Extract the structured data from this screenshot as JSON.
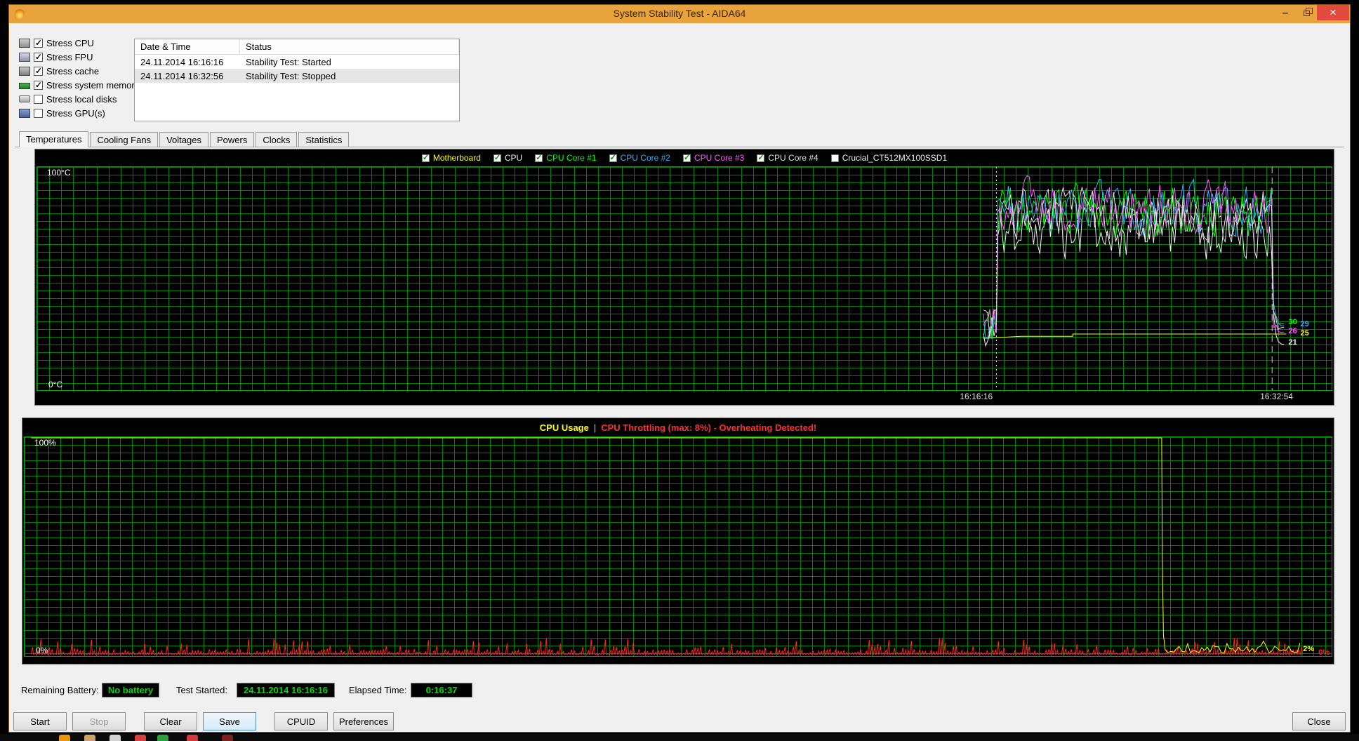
{
  "window": {
    "title": "System Stability Test - AIDA64"
  },
  "stress_options": {
    "items": [
      {
        "label": "Stress CPU",
        "checked": true,
        "icon": "cpu-icon"
      },
      {
        "label": "Stress FPU",
        "checked": true,
        "icon": "fpu-icon"
      },
      {
        "label": "Stress cache",
        "checked": true,
        "icon": "cache-icon"
      },
      {
        "label": "Stress system memory",
        "checked": true,
        "icon": "memory-icon"
      },
      {
        "label": "Stress local disks",
        "checked": false,
        "icon": "disk-icon"
      },
      {
        "label": "Stress GPU(s)",
        "checked": false,
        "icon": "gpu-icon"
      }
    ]
  },
  "log_table": {
    "columns": [
      "Date & Time",
      "Status"
    ],
    "rows": [
      {
        "datetime": "24.11.2014 16:16:16",
        "status": "Stability Test: Started",
        "selected": false
      },
      {
        "datetime": "24.11.2014 16:32:56",
        "status": "Stability Test: Stopped",
        "selected": true
      }
    ]
  },
  "tabs": {
    "items": [
      {
        "label": "Temperatures",
        "active": true
      },
      {
        "label": "Cooling Fans",
        "active": false
      },
      {
        "label": "Voltages",
        "active": false
      },
      {
        "label": "Powers",
        "active": false
      },
      {
        "label": "Clocks",
        "active": false
      },
      {
        "label": "Statistics",
        "active": false
      }
    ]
  },
  "status_bar": {
    "battery_label": "Remaining Battery:",
    "battery_value": "No battery",
    "started_label": "Test Started:",
    "started_value": "24.11.2014 16:16:16",
    "elapsed_label": "Elapsed Time:",
    "elapsed_value": "0:16:37"
  },
  "buttons": {
    "start": "Start",
    "stop": "Stop",
    "clear": "Clear",
    "save": "Save",
    "cpuid": "CPUID",
    "preferences": "Preferences",
    "close": "Close"
  },
  "taskbar": {
    "icons": [
      {
        "name": "taskbar-app-icon-1",
        "color": "#e8960f",
        "x": 84
      },
      {
        "name": "taskbar-app-icon-2",
        "color": "#c9a36a",
        "x": 120
      },
      {
        "name": "taskbar-app-icon-3",
        "color": "#d2d2d2",
        "x": 156
      },
      {
        "name": "taskbar-app-icon-4",
        "color": "#d64040",
        "x": 192
      },
      {
        "name": "taskbar-app-icon-5",
        "color": "#2f9e3f",
        "x": 224
      },
      {
        "name": "taskbar-app-icon-6",
        "color": "#cf3a3a",
        "x": 266
      },
      {
        "name": "taskbar-app-icon-7",
        "color": "#7e1f1f",
        "x": 316
      }
    ]
  },
  "chart_data": [
    {
      "type": "line",
      "title": "Temperatures",
      "grid": true,
      "bg_color": "#000000",
      "grid_color": "#009600",
      "y_axis": {
        "min": 0,
        "max": 100,
        "top_label": "100°C",
        "bottom_label": "0°C"
      },
      "x_ticks": [
        {
          "label": "16:16:16",
          "frac": 0.728
        },
        {
          "label": "16:32:54",
          "frac": 0.96
        }
      ],
      "events": {
        "data_start_frac": 0.731,
        "start_line_frac": 0.741,
        "stop_line_frac": 0.954,
        "data_end_frac": 0.965
      },
      "legend": [
        {
          "name": "Motherboard",
          "color": "#ffff00",
          "checked": true
        },
        {
          "name": "CPU",
          "color": "#f0f0f0",
          "checked": true
        },
        {
          "name": "CPU Core #1",
          "color": "#00ff00",
          "checked": true
        },
        {
          "name": "CPU Core #2",
          "color": "#35b1ff",
          "checked": true
        },
        {
          "name": "CPU Core #3",
          "color": "#ff5cff",
          "checked": true
        },
        {
          "name": "CPU Core #4",
          "color": "#e0e0e0",
          "checked": true
        },
        {
          "name": "Crucial_CT512MX100SSD1",
          "color": "#f0f0f0",
          "checked": false
        }
      ],
      "series": [
        {
          "name": "Motherboard",
          "color": "#ffff00",
          "render": "steps",
          "points": [
            [
              0.731,
              23
            ],
            [
              0.76,
              24
            ],
            [
              0.8,
              24
            ],
            [
              0.8,
              25
            ],
            [
              0.9,
              25
            ],
            [
              0.935,
              25
            ],
            [
              0.965,
              25
            ]
          ],
          "end_label": "25",
          "end_label_value": 25
        },
        {
          "name": "CPU",
          "color": "#f0f0f0",
          "render": "stress",
          "idle": 26,
          "band_min": 55,
          "band_max": 90,
          "end_value": 21,
          "end_label": "21",
          "end_label_value": 21
        },
        {
          "name": "CPU Core #1",
          "color": "#00ff00",
          "render": "stress",
          "idle": 30,
          "band_min": 64,
          "band_max": 95,
          "end_value": 30,
          "end_label": "30",
          "end_label_value": 30
        },
        {
          "name": "CPU Core #2",
          "color": "#35b1ff",
          "render": "stress",
          "idle": 31,
          "band_min": 66,
          "band_max": 96,
          "end_value": 29,
          "end_label": "29",
          "end_label_value": 29
        },
        {
          "name": "CPU Core #3",
          "color": "#ff5cff",
          "render": "stress",
          "idle": 32,
          "band_min": 68,
          "band_max": 97,
          "end_value": 26,
          "end_label": "26",
          "end_label_value": 26
        },
        {
          "name": "CPU Core #4",
          "color": "#e0e0e0",
          "render": "stress",
          "idle": 29,
          "band_min": 64,
          "band_max": 94,
          "end_value": 28,
          "end_label": "",
          "end_label_value": 28
        }
      ]
    },
    {
      "type": "line",
      "title_parts": {
        "left": "CPU Usage",
        "separator": "|",
        "right": "CPU Throttling (max: 8%) - Overheating Detected!"
      },
      "grid": true,
      "bg_color": "#000000",
      "grid_color": "#009600",
      "y_axis": {
        "min": 0,
        "max": 100,
        "top_label": "100%",
        "bottom_label": "0%"
      },
      "events": {
        "data_start_frac": 0.005,
        "drop_frac": 0.87,
        "data_end_frac": 0.976
      },
      "series": [
        {
          "name": "CPU Usage",
          "color": "#ffff00",
          "render": "usage",
          "high": 100,
          "low_min": 1,
          "low_max": 5,
          "end_label": "2%",
          "end_label_value": 2
        },
        {
          "name": "CPU Throttling",
          "color": "#ff2222",
          "render": "spikes",
          "max": 8,
          "end_label": "0%",
          "end_label_value": 0
        }
      ]
    }
  ]
}
